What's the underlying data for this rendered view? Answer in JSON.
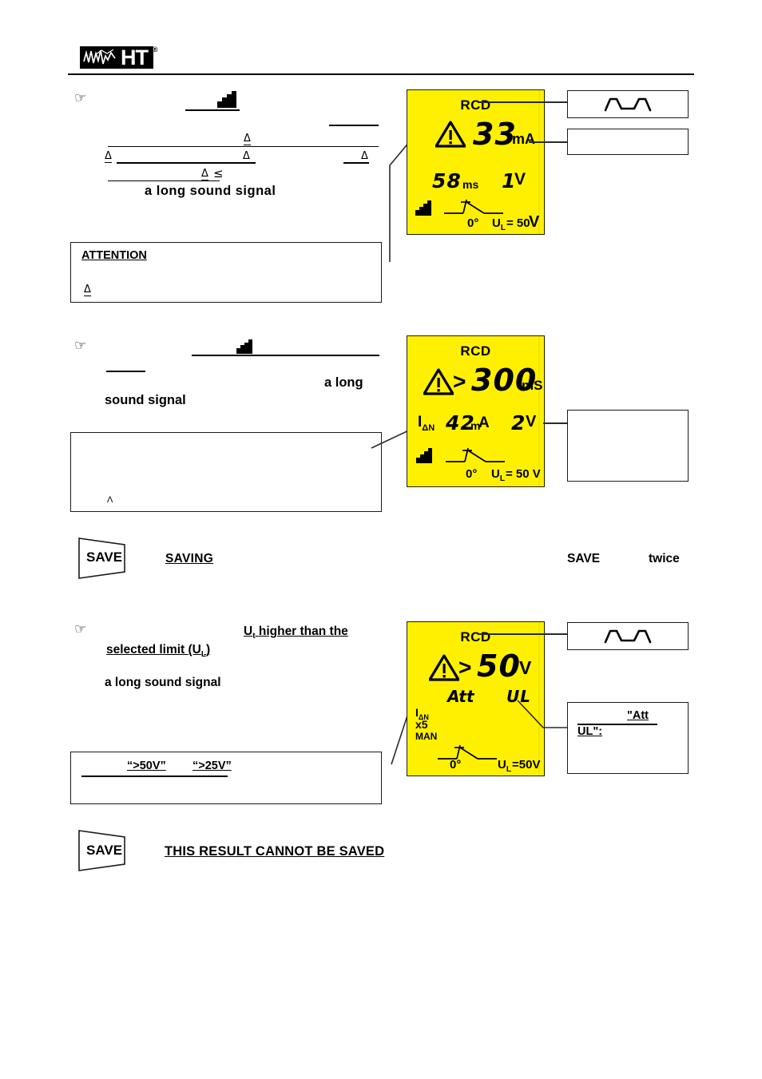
{
  "document": {
    "brand": "HT",
    "brand_registered": "®"
  },
  "sections": [
    {
      "id": "section-1",
      "marker": "☞",
      "body_note": "a long sound signal",
      "delta_marks": [
        "Δ",
        "Δ",
        "Δ",
        "Δ",
        "Δ",
        "Δ"
      ],
      "le_symbol": "≤",
      "attention": {
        "title": "ATTENTION",
        "delta": "Δ"
      },
      "display": {
        "title": "RCD",
        "warning_icon": "warning-triangle",
        "value": "33",
        "unit": "mA",
        "time_value": "58",
        "time_unit": "ms",
        "voltage_value": "1",
        "voltage_unit": "V",
        "bars_icon": "signal-bars-icon",
        "switch_icon": "switch-icon",
        "angle": "0°",
        "limit_label": "U",
        "limit_sub": "L",
        "limit_value": "= 50",
        "limit_unit": "V"
      },
      "callouts": [
        {
          "id": "callout-waveform-1",
          "icon": "ac-waveform-icon",
          "text": ""
        },
        {
          "id": "callout-empty-1",
          "icon": "",
          "text": ""
        }
      ]
    },
    {
      "id": "section-2",
      "marker": "☞",
      "phrase_a": "a   long",
      "phrase_b": "sound  signal",
      "note_box_mark": "Λ",
      "display": {
        "title": "RCD",
        "warning_icon": "warning-triangle",
        "gt": ">",
        "value": "300",
        "unit": "mS",
        "current_label": "I",
        "current_sub": "ΔN",
        "current_value": "42",
        "current_unit": "mA",
        "voltage_value": "2",
        "voltage_unit": "V",
        "bars_icon": "signal-bars-icon",
        "switch_icon": "switch-icon",
        "angle": "0°",
        "limit_label": "U",
        "limit_sub": "L",
        "limit_value": "= 50 V"
      },
      "callouts": [
        {
          "id": "callout-empty-2",
          "icon": "",
          "text": ""
        }
      ],
      "save_row": {
        "key_label": "SAVE",
        "saving_label": "SAVING",
        "save_word": "SAVE",
        "twice_word": "twice"
      }
    },
    {
      "id": "section-3",
      "marker": "☞",
      "headline_line1": "U",
      "headline_sub1": "t",
      "headline_line1_rest": " higher than the",
      "headline_line2": "selected   limit   (U",
      "headline_sub2": "L",
      "headline_line2_rest": ")",
      "sound_note": "a long sound signal",
      "limits_box": {
        "value_high": "“>50V”",
        "value_low": "“>25V”"
      },
      "display": {
        "title": "RCD",
        "warning_icon": "warning-triangle",
        "gt": ">",
        "value": "50",
        "unit": "V",
        "att_text": "Att",
        "ul_text": "UL",
        "current_label": "I",
        "current_sub": "ΔN",
        "multiplier": "x5",
        "mode": "MAN",
        "switch_icon": "switch-icon",
        "angle": "0°",
        "limit_label": "U",
        "limit_sub": "L",
        "limit_value": "=50V"
      },
      "callouts": [
        {
          "id": "callout-waveform-2",
          "icon": "ac-waveform-icon",
          "text": ""
        },
        {
          "id": "callout-att-ul",
          "line1": "\"Att",
          "line2": "UL\":"
        }
      ],
      "save_row": {
        "key_label": "SAVE",
        "message": "THIS RESULT CANNOT BE SAVED"
      }
    }
  ],
  "colors": {
    "lcd_background": "#fff000",
    "ink": "#000000",
    "border": "#1a1a1a"
  }
}
